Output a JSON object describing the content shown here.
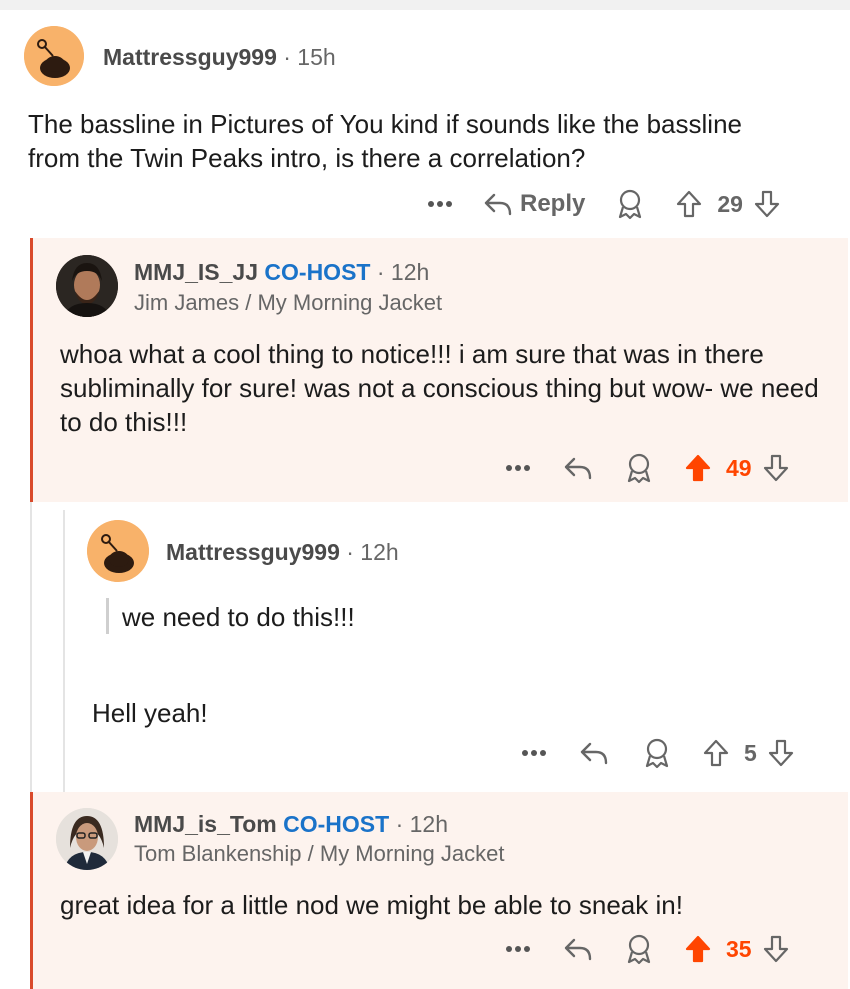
{
  "colors": {
    "accent": "#ff4500",
    "cohost": "#1a73c9",
    "panel": "#fdf3ee"
  },
  "comments": [
    {
      "username": "Mattressguy999",
      "time": "· 15h",
      "body": "The bassline in Pictures of You kind if sounds like the bassline from the Twin Peaks intro, is there a correlation?",
      "reply_label": "Reply",
      "score": "29",
      "upvoted": false
    },
    {
      "username": "MMJ_IS_JJ",
      "badge": "CO-HOST",
      "time": "· 12h",
      "flair": "Jim James / My Morning Jacket",
      "body": "whoa what a cool thing to notice!!! i am sure that was in there subliminally for sure! was not a conscious thing but wow- we need to do this!!!",
      "score": "49",
      "upvoted": true
    },
    {
      "username": "Mattressguy999",
      "time": "· 12h",
      "quote": "we need to do this!!!",
      "body": "Hell yeah!",
      "score": "5",
      "upvoted": false
    },
    {
      "username": "MMJ_is_Tom",
      "badge": "CO-HOST",
      "time": "· 12h",
      "flair": "Tom Blankenship / My Morning Jacket",
      "body": "great idea for a little nod we might be able to sneak in!",
      "score": "35",
      "upvoted": true
    }
  ]
}
